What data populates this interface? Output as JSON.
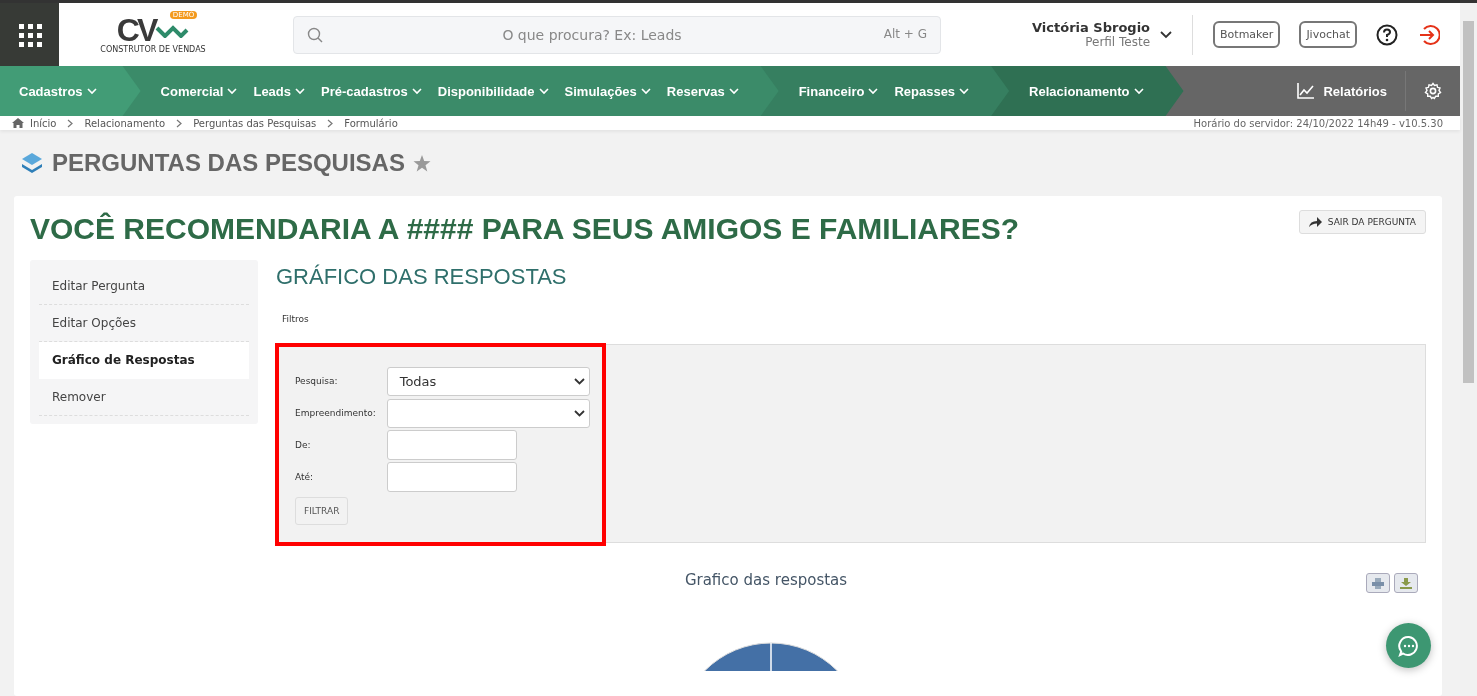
{
  "logo": {
    "letters": "CV",
    "badge": "DEMO",
    "tagline": "CONSTRUTOR DE VENDAS"
  },
  "search": {
    "placeholder": "O que procura? Ex: Leads",
    "shortcut": "Alt + G"
  },
  "user": {
    "name": "Victória Sbrogio",
    "profile": "Perfil Teste"
  },
  "header_buttons": [
    "Botmaker",
    "Jivochat"
  ],
  "nav": {
    "groups": [
      {
        "color": "#429c76",
        "items": [
          "Cadastros"
        ]
      },
      {
        "color": "#3b8b69",
        "items": [
          "Comercial",
          "Leads",
          "Pré-cadastros",
          "Disponibilidade",
          "Simulações",
          "Reservas"
        ]
      },
      {
        "color": "#367f60",
        "items": [
          "Financeiro",
          "Repasses"
        ]
      },
      {
        "color": "#2f7053",
        "items": [
          "Relacionamento"
        ]
      }
    ],
    "reports": "Relatórios"
  },
  "breadcrumb": [
    "Início",
    "Relacionamento",
    "Perguntas das Pesquisas",
    "Formulário"
  ],
  "server_time": "Horário do servidor: 24/10/2022 14h49 - v10.5.30",
  "page_title": "PERGUNTAS DAS PESQUISAS",
  "question_title": "VOCÊ RECOMENDARIA A #### PARA SEUS AMIGOS E FAMILIARES?",
  "exit_button": "SAIR DA PERGUNTA",
  "side_menu": [
    {
      "label": "Editar Pergunta",
      "selected": false
    },
    {
      "label": "Editar Opções",
      "selected": false
    },
    {
      "label": "Gráfico de Respostas",
      "selected": true
    },
    {
      "label": "Remover",
      "selected": false
    }
  ],
  "section_title": "GRÁFICO DAS RESPOSTAS",
  "filters_label": "Filtros",
  "filters": [
    {
      "kind": "select",
      "label": "Pesquisa:",
      "value": "Todas"
    },
    {
      "kind": "select",
      "label": "Empreendimento:"
    },
    {
      "kind": "text",
      "label": "De:"
    },
    {
      "kind": "text",
      "label": "Até:"
    }
  ],
  "filter_button": "FILTRAR",
  "chart_title": "Grafico das respostas"
}
